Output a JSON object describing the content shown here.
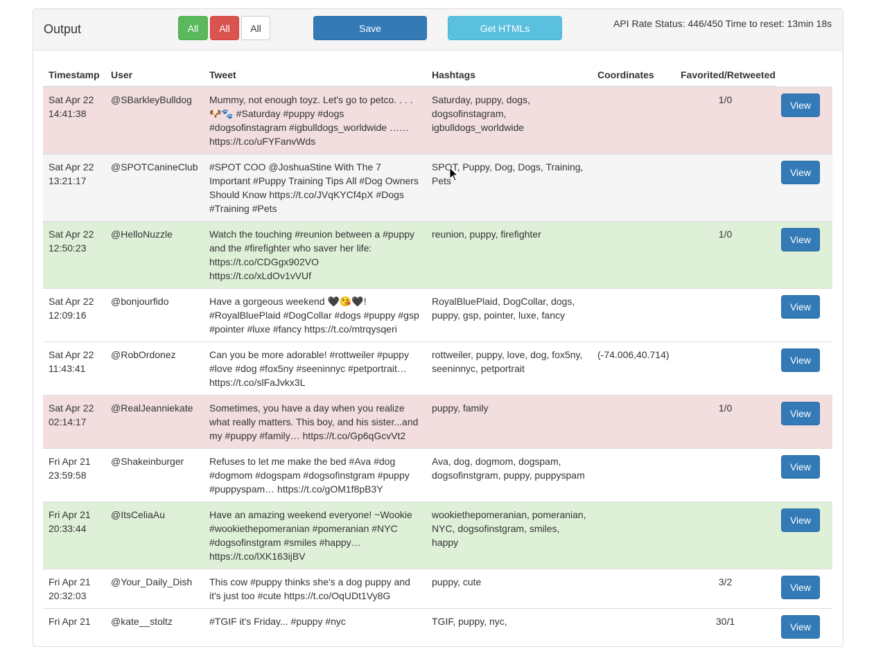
{
  "panel": {
    "title": "Output"
  },
  "filters": {
    "all_green": "All",
    "all_red": "All",
    "all_default": "All"
  },
  "actions": {
    "save": "Save",
    "get_htmls": "Get HTMLs"
  },
  "rate_status": "API Rate Status: 446/450 Time to reset: 13min 18s",
  "table": {
    "headers": {
      "timestamp": "Timestamp",
      "user": "User",
      "tweet": "Tweet",
      "hashtags": "Hashtags",
      "coordinates": "Coordinates",
      "fav": "Favorited/Retweeted"
    },
    "view_label": "View",
    "rows": [
      {
        "status": "danger",
        "date": "Sat Apr 22",
        "time": "14:41:38",
        "user": "@SBarkleyBulldog",
        "tweet": "Mummy, not enough toyz. Let's go to petco. . . . 🐶🐾 #Saturday #puppy #dogs #dogsofinstagram #igbulldogs_worldwide …… https://t.co/uFYFanvWds",
        "hashtags": "Saturday, puppy, dogs, dogsofinstagram, igbulldogs_worldwide",
        "coordinates": "",
        "fav": "1/0"
      },
      {
        "status": "striped",
        "date": "Sat Apr 22",
        "time": "13:21:17",
        "user": "@SPOTCanineClub",
        "tweet": "#SPOT COO @JoshuaStine With The 7 Important #Puppy Training Tips All #Dog Owners Should Know https://t.co/JVqKYCf4pX #Dogs #Training #Pets",
        "hashtags": "SPOT, Puppy, Dog, Dogs, Training, Pets",
        "coordinates": "",
        "fav": ""
      },
      {
        "status": "success",
        "date": "Sat Apr 22",
        "time": "12:50:23",
        "user": "@HelloNuzzle",
        "tweet": "Watch the touching #reunion between a #puppy and the #firefighter who saver her life: https://t.co/CDGgx902VO https://t.co/xLdOv1vVUf",
        "hashtags": "reunion, puppy, firefighter",
        "coordinates": "",
        "fav": "1/0"
      },
      {
        "status": "none",
        "date": "Sat Apr 22",
        "time": "12:09:16",
        "user": "@bonjourfido",
        "tweet": "Have a gorgeous weekend 🖤😘🖤! #RoyalBluePlaid #DogCollar #dogs #puppy #gsp #pointer #luxe #fancy https://t.co/mtrqysqeri",
        "hashtags": "RoyalBluePlaid, DogCollar, dogs, puppy, gsp, pointer, luxe, fancy",
        "coordinates": "",
        "fav": ""
      },
      {
        "status": "none",
        "date": "Sat Apr 22",
        "time": "11:43:41",
        "user": "@RobOrdonez",
        "tweet": "Can you be more adorable! #rottweiler #puppy #love #dog #fox5ny #seeninnyc #petportrait… https://t.co/slFaJvkx3L",
        "hashtags": "rottweiler, puppy, love, dog, fox5ny, seeninnyc, petportrait",
        "coordinates": "(-74.006,40.714)",
        "fav": ""
      },
      {
        "status": "danger",
        "date": "Sat Apr 22",
        "time": "02:14:17",
        "user": "@RealJeanniekate",
        "tweet": "Sometimes, you have a day when you realize what really matters. This boy, and his sister...and my #puppy #family… https://t.co/Gp6qGcvVt2",
        "hashtags": "puppy, family",
        "coordinates": "",
        "fav": "1/0"
      },
      {
        "status": "none",
        "date": "Fri Apr 21",
        "time": "23:59:58",
        "user": "@Shakeinburger",
        "tweet": "Refuses to let me make the bed #Ava #dog #dogmom #dogspam #dogsofinstgram #puppy #puppyspam… https://t.co/gOM1f8pB3Y",
        "hashtags": "Ava, dog, dogmom, dogspam, dogsofinstgram, puppy, puppyspam",
        "coordinates": "",
        "fav": ""
      },
      {
        "status": "success",
        "date": "Fri Apr 21",
        "time": "20:33:44",
        "user": "@ItsCeliaAu",
        "tweet": "Have an amazing weekend everyone! ~Wookie #wookiethepomeranian #pomeranian #NYC #dogsofinstgram #smiles #happy… https://t.co/lXK163ijBV",
        "hashtags": "wookiethepomeranian, pomeranian, NYC, dogsofinstgram, smiles, happy",
        "coordinates": "",
        "fav": ""
      },
      {
        "status": "none",
        "date": "Fri Apr 21",
        "time": "20:32:03",
        "user": "@Your_Daily_Dish",
        "tweet": "This cow #puppy thinks she's a dog puppy and it's just too #cute https://t.co/OqUDt1Vy8G",
        "hashtags": "puppy, cute",
        "coordinates": "",
        "fav": "3/2"
      },
      {
        "status": "none",
        "date": "Fri Apr 21",
        "time": "",
        "user": "@kate__stoltz",
        "tweet": "#TGIF it's Friday... #puppy #nyc",
        "hashtags": "TGIF, puppy, nyc,",
        "coordinates": "",
        "fav": "30/1"
      }
    ]
  },
  "colors": {
    "success": "#5cb85c",
    "danger": "#d9534f",
    "primary": "#337ab7",
    "info": "#5bc0de",
    "row_danger": "#f2dede",
    "row_success": "#dff0d8"
  }
}
